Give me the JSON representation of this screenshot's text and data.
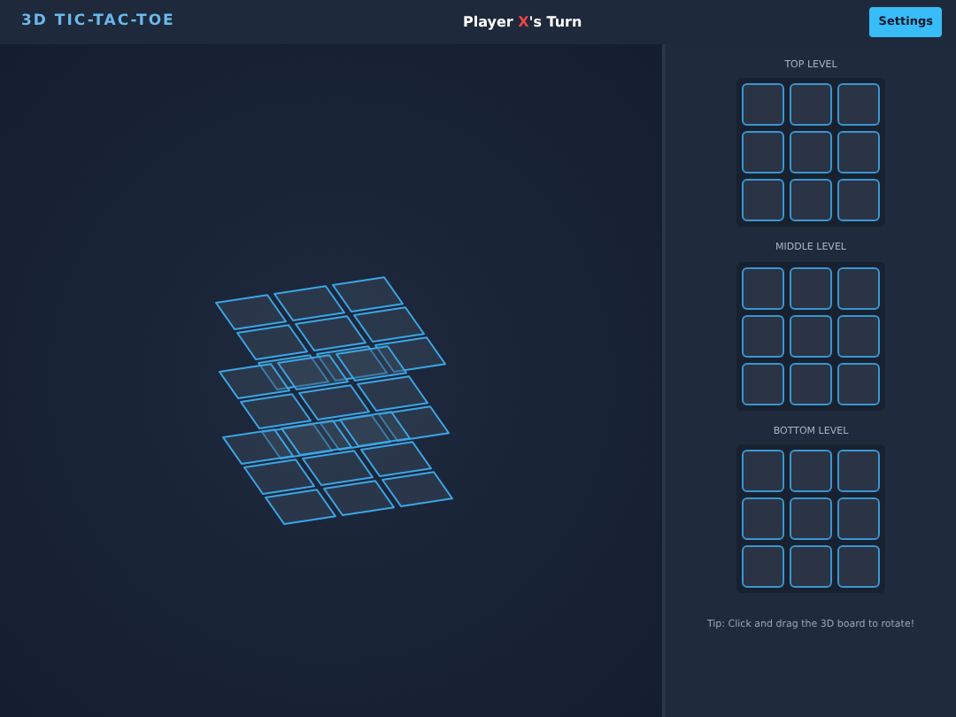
{
  "header": {
    "title": "3D TIC-TAC-TOE",
    "turn": {
      "prefix": "Player ",
      "player": "X",
      "suffix": "'s Turn"
    },
    "settings_button": "Settings"
  },
  "levels": [
    {
      "label": "TOP LEVEL"
    },
    {
      "label": "MIDDLE LEVEL"
    },
    {
      "label": "BOTTOM LEVEL"
    }
  ],
  "tip": "Tip: Click and drag the 3D board to rotate!"
}
